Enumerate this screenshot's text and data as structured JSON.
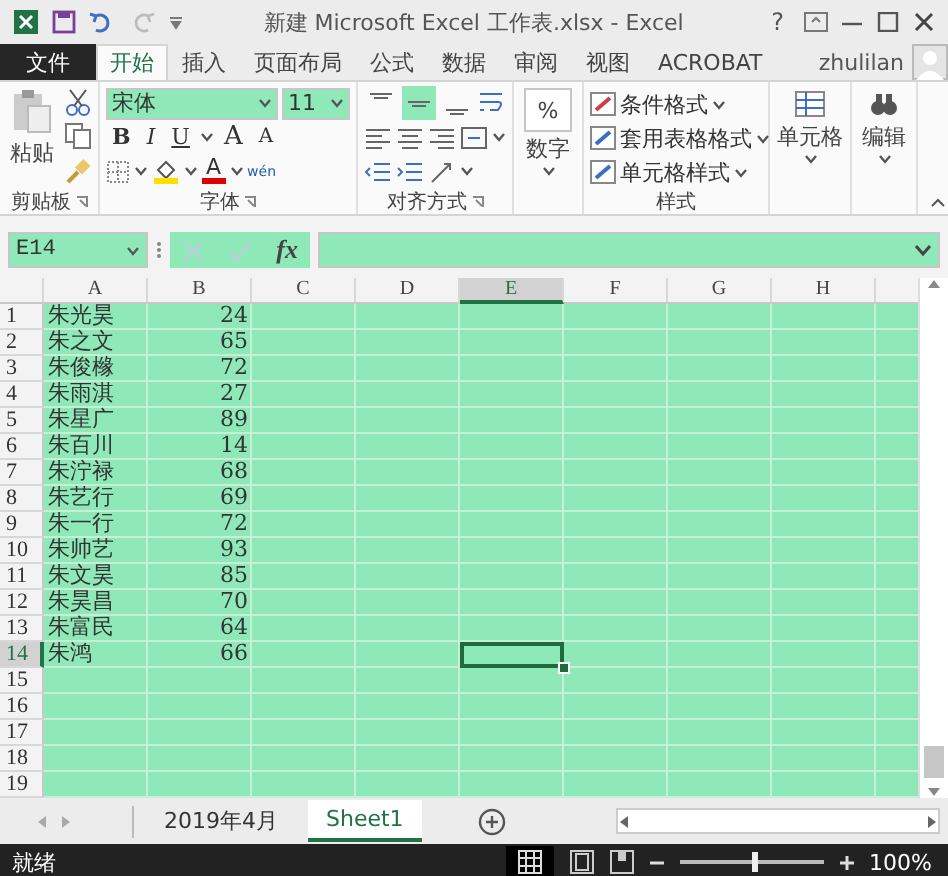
{
  "window": {
    "title": "新建 Microsoft Excel 工作表.xlsx - Excel",
    "help": "?"
  },
  "tabs": [
    {
      "label": "文件",
      "kind": "file",
      "selected": false
    },
    {
      "label": "开始",
      "kind": "tab",
      "selected": true
    },
    {
      "label": "插入",
      "kind": "tab",
      "selected": false
    },
    {
      "label": "页面布局",
      "kind": "tab",
      "selected": false
    },
    {
      "label": "公式",
      "kind": "tab",
      "selected": false
    },
    {
      "label": "数据",
      "kind": "tab",
      "selected": false
    },
    {
      "label": "审阅",
      "kind": "tab",
      "selected": false
    },
    {
      "label": "视图",
      "kind": "tab",
      "selected": false
    },
    {
      "label": "ACROBAT",
      "kind": "tab",
      "selected": false
    }
  ],
  "account": {
    "user": "zhulilan"
  },
  "ribbon": {
    "clipboard": {
      "paste": "粘贴",
      "label": "剪贴板"
    },
    "font": {
      "name": "宋体",
      "size": "11",
      "format_buttons": [
        "B",
        "I",
        "U"
      ],
      "size_buttons": [
        "A",
        "A"
      ],
      "font_color": "A",
      "phonetic": "wén",
      "label": "字体"
    },
    "alignment": {
      "vertical_align": [
        {
          "kind": "top",
          "selected": false
        },
        {
          "kind": "middle",
          "selected": true
        },
        {
          "kind": "bottom",
          "selected": false
        }
      ],
      "label": "对齐方式"
    },
    "number": {
      "symbol": "%",
      "button": "数字"
    },
    "styles": {
      "items": [
        "条件格式",
        "套用表格格式",
        "单元格样式"
      ],
      "label": "样式"
    },
    "cells": {
      "button": "单元格"
    },
    "editing": {
      "button": "编辑"
    }
  },
  "formula_bar": {
    "name_box": "E14",
    "function_label": "fx"
  },
  "sheet": {
    "columns": [
      {
        "label": "A",
        "selected": false
      },
      {
        "label": "B",
        "selected": false
      },
      {
        "label": "C",
        "selected": false
      },
      {
        "label": "D",
        "selected": false
      },
      {
        "label": "E",
        "selected": true
      },
      {
        "label": "F",
        "selected": false
      },
      {
        "label": "G",
        "selected": false
      },
      {
        "label": "H",
        "selected": false
      }
    ],
    "rows": [
      {
        "number": "1",
        "cells": [
          {
            "text": "朱光昊",
            "kind": "text"
          },
          {
            "text": "24",
            "kind": "number"
          }
        ],
        "selected": false
      },
      {
        "number": "2",
        "cells": [
          {
            "text": "朱之文",
            "kind": "text"
          },
          {
            "text": "65",
            "kind": "number"
          }
        ],
        "selected": false
      },
      {
        "number": "3",
        "cells": [
          {
            "text": "朱俊橼",
            "kind": "text"
          },
          {
            "text": "72",
            "kind": "number"
          }
        ],
        "selected": false
      },
      {
        "number": "4",
        "cells": [
          {
            "text": "朱雨淇",
            "kind": "text"
          },
          {
            "text": "27",
            "kind": "number"
          }
        ],
        "selected": false
      },
      {
        "number": "5",
        "cells": [
          {
            "text": "朱星广",
            "kind": "text"
          },
          {
            "text": "89",
            "kind": "number"
          }
        ],
        "selected": false
      },
      {
        "number": "6",
        "cells": [
          {
            "text": "朱百川",
            "kind": "text"
          },
          {
            "text": "14",
            "kind": "number"
          }
        ],
        "selected": false
      },
      {
        "number": "7",
        "cells": [
          {
            "text": "朱泞禄",
            "kind": "text"
          },
          {
            "text": "68",
            "kind": "number"
          }
        ],
        "selected": false
      },
      {
        "number": "8",
        "cells": [
          {
            "text": "朱艺行",
            "kind": "text"
          },
          {
            "text": "69",
            "kind": "number"
          }
        ],
        "selected": false
      },
      {
        "number": "9",
        "cells": [
          {
            "text": "朱一行",
            "kind": "text"
          },
          {
            "text": "72",
            "kind": "number"
          }
        ],
        "selected": false
      },
      {
        "number": "10",
        "cells": [
          {
            "text": "朱帅艺",
            "kind": "text"
          },
          {
            "text": "93",
            "kind": "number"
          }
        ],
        "selected": false
      },
      {
        "number": "11",
        "cells": [
          {
            "text": "朱文昊",
            "kind": "text"
          },
          {
            "text": "85",
            "kind": "number"
          }
        ],
        "selected": false
      },
      {
        "number": "12",
        "cells": [
          {
            "text": "朱昊昌",
            "kind": "text"
          },
          {
            "text": "70",
            "kind": "number"
          }
        ],
        "selected": false
      },
      {
        "number": "13",
        "cells": [
          {
            "text": "朱富民",
            "kind": "text"
          },
          {
            "text": "64",
            "kind": "number"
          }
        ],
        "selected": false
      },
      {
        "number": "14",
        "cells": [
          {
            "text": "朱鸿",
            "kind": "text"
          },
          {
            "text": "66",
            "kind": "number"
          }
        ],
        "selected": true
      },
      {
        "number": "15",
        "selected": false
      },
      {
        "number": "16",
        "selected": false
      },
      {
        "number": "17",
        "selected": false
      },
      {
        "number": "18",
        "selected": false
      },
      {
        "number": "19",
        "selected": false
      }
    ]
  },
  "sheet_tabs": [
    {
      "label": "2019年4月",
      "selected": false
    },
    {
      "label": "Sheet1",
      "selected": true
    }
  ],
  "status_bar": {
    "status": "就绪",
    "zoom": {
      "level": 0.5,
      "reading": "100%"
    }
  }
}
